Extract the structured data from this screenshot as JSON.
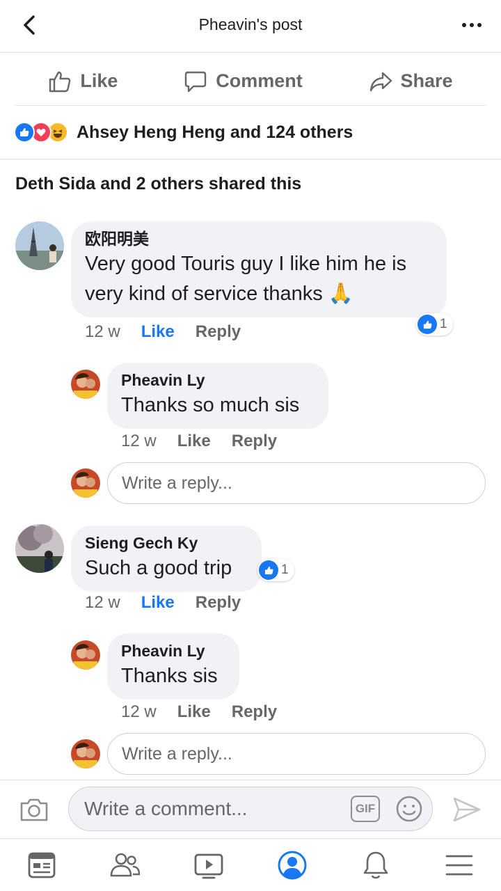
{
  "header": {
    "title": "Pheavin's post"
  },
  "actions": {
    "like": "Like",
    "comment": "Comment",
    "share": "Share"
  },
  "reactions": {
    "summary": "Ahsey Heng Heng and 124 others",
    "types": [
      "like-icon",
      "love-icon",
      "haha-icon"
    ]
  },
  "shares": {
    "text": "Deth Sida and 2 others shared this"
  },
  "comments": [
    {
      "author": "欧阳明美",
      "text_line1": "Very good Touris guy I like him he is",
      "text_line2": "very kind of service thanks 🙏",
      "time": "12 w",
      "like_label": "Like",
      "reply_label": "Reply",
      "like_count": "1",
      "replies": [
        {
          "author": "Pheavin Ly",
          "text": "Thanks so much sis",
          "time": "12 w",
          "like_label": "Like",
          "reply_label": "Reply"
        }
      ],
      "reply_placeholder": "Write a reply..."
    },
    {
      "author": "Sieng Gech Ky",
      "text": "Such a good trip",
      "time": "12 w",
      "like_label": "Like",
      "reply_label": "Reply",
      "like_count": "1",
      "replies": [
        {
          "author": "Pheavin Ly",
          "text": "Thanks sis",
          "time": "12 w",
          "like_label": "Like",
          "reply_label": "Reply"
        }
      ],
      "reply_placeholder": "Write a reply..."
    }
  ],
  "composer": {
    "placeholder": "Write a comment...",
    "gif_label": "GIF"
  },
  "tabs": [
    "news-feed-icon",
    "friends-icon",
    "watch-icon",
    "profile-icon",
    "notifications-icon",
    "menu-icon"
  ],
  "colors": {
    "accent": "#1877f2",
    "secondary_text": "#65676b",
    "bubble": "#f0f2f5"
  }
}
